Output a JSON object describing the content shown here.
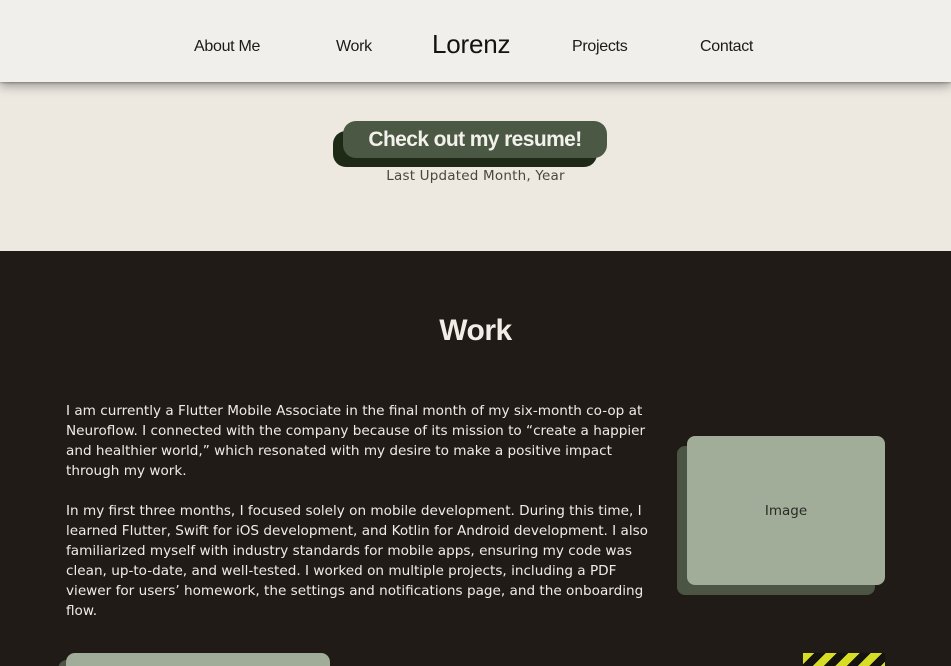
{
  "nav": {
    "about": "About Me",
    "work": "Work",
    "brand": "Lorenz",
    "projects": "Projects",
    "contact": "Contact"
  },
  "resume": {
    "button_label": "Check out my resume!",
    "updated": "Last Updated Month, Year"
  },
  "work": {
    "title": "Work",
    "paragraphs": [
      "I am currently a Flutter Mobile Associate in the final month of my six-month co-op at Neuroflow. I connected with the company because of its mission to “create a happier and healthier world,” which resonated with my desire to make a positive impact through my work.",
      "In my first three months, I focused solely on mobile development. During this time, I learned Flutter, Swift for iOS development, and Kotlin for Android development. I also familiarized myself with industry standards for mobile apps, ensuring my code was clean, up-to-date, and well-tested. I worked on multiple projects, including a PDF viewer for users’ homework, the settings and notifications page, and the onboarding flow."
    ],
    "image_label": "Image"
  },
  "colors": {
    "top_background": "#ede9e1",
    "navbar": "#f1efeb",
    "dark_background": "#211b17",
    "button_green": "#4b5843",
    "button_shadow": "#1e2a16",
    "image_card": "#a1ad98",
    "image_shadow": "#4c5443",
    "hazard_yellow": "#d7dc24"
  }
}
